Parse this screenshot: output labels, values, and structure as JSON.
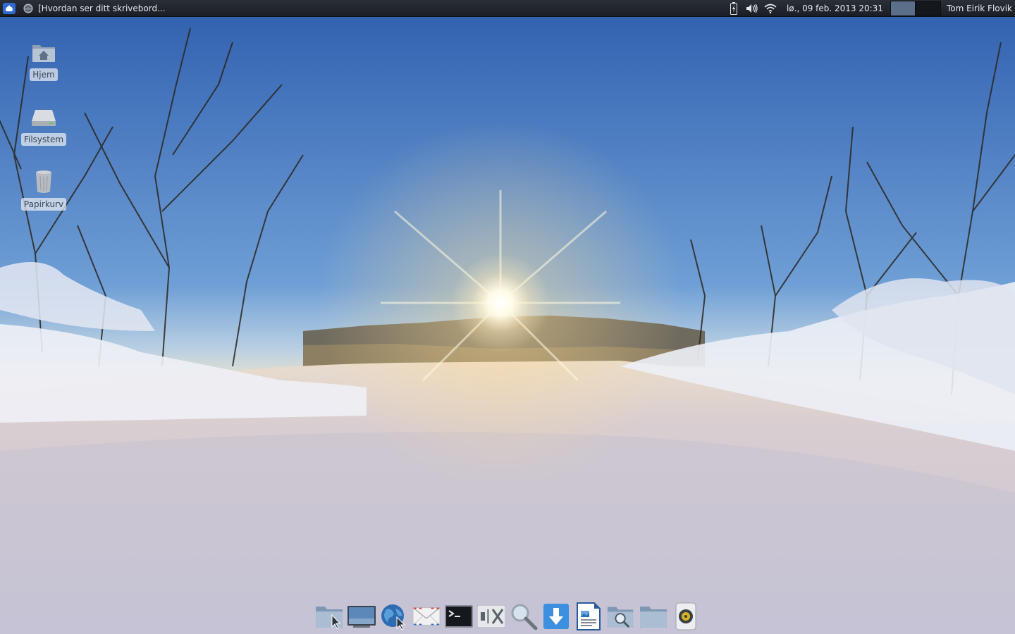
{
  "panel": {
    "task_title": "[Hvordan ser ditt skrivebord...",
    "clock": "lø., 09 feb. 2013 20:31",
    "user_name": "Tom Eirik Flovik",
    "colors": {
      "panel_bg": "#1f242b",
      "panel_text": "#e6e9ee",
      "active_workspace": "#5b6f8a"
    }
  },
  "desktop": {
    "icons": [
      {
        "label": "Hjem",
        "icon": "home-folder-icon"
      },
      {
        "label": "Filsystem",
        "icon": "hard-drive-icon"
      },
      {
        "label": "Papirkurv",
        "icon": "trash-icon"
      }
    ]
  },
  "dock": {
    "items": [
      {
        "icon": "file-manager-icon"
      },
      {
        "icon": "show-desktop-icon"
      },
      {
        "icon": "web-browser-icon"
      },
      {
        "icon": "mail-icon"
      },
      {
        "icon": "terminal-icon"
      },
      {
        "icon": "settings-icon"
      },
      {
        "icon": "search-icon"
      },
      {
        "icon": "download-icon"
      },
      {
        "icon": "document-viewer-icon"
      },
      {
        "icon": "file-search-icon"
      },
      {
        "icon": "folder-icon"
      },
      {
        "icon": "music-player-icon"
      }
    ]
  }
}
